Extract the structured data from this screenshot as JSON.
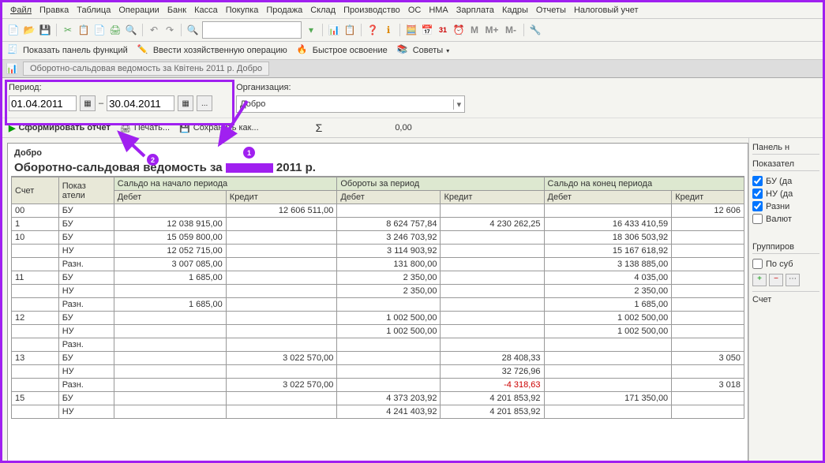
{
  "menu": [
    "Файл",
    "Правка",
    "Таблица",
    "Операции",
    "Банк",
    "Касса",
    "Покупка",
    "Продажа",
    "Склад",
    "Производство",
    "ОС",
    "НМА",
    "Зарплата",
    "Кадры",
    "Отчеты",
    "Налоговый учет"
  ],
  "toolbar2": {
    "show_panel": "Показать панель функций",
    "manual_op": "Ввести хозяйственную операцию",
    "quick_learn": "Быстрое освоение",
    "tips": "Советы"
  },
  "tab": {
    "title": "Оборотно-сальдовая ведомость за Квітень 2011 р. Добро"
  },
  "params": {
    "period_label": "Период:",
    "date_from": "01.04.2011",
    "dash": "–",
    "date_to": "30.04.2011",
    "dots": "...",
    "org_label": "Организация:",
    "org_value": "Добро"
  },
  "actions": {
    "form": "Сформировать отчет",
    "print": "Печать...",
    "save": "Сохранить как...",
    "sigma": "Σ",
    "sum": "0,00"
  },
  "report": {
    "company": "Добро",
    "title_pre": "Оборотно-сальдовая ведомость за ",
    "title_post": " 2011 р.",
    "cols": {
      "acct": "Счет",
      "indic": "Показ\nатели",
      "start": "Сальдо на начало периода",
      "turn": "Обороты за период",
      "end": "Сальдо на конец периода",
      "debit": "Дебет",
      "credit": "Кредит"
    },
    "rows": [
      {
        "a": "00",
        "i": "БУ",
        "sd": "",
        "sc": "12 606 511,00",
        "td": "",
        "tc": "",
        "ed": "",
        "ec": "12 606"
      },
      {
        "a": "1",
        "i": "БУ",
        "sd": "12 038 915,00",
        "sc": "",
        "td": "8 624 757,84",
        "tc": "4 230 262,25",
        "ed": "16 433 410,59",
        "ec": ""
      },
      {
        "a": "10",
        "i": "БУ",
        "sd": "15 059 800,00",
        "sc": "",
        "td": "3 246 703,92",
        "tc": "",
        "ed": "18 306 503,92",
        "ec": ""
      },
      {
        "a": "",
        "i": "НУ",
        "sd": "12 052 715,00",
        "sc": "",
        "td": "3 114 903,92",
        "tc": "",
        "ed": "15 167 618,92",
        "ec": ""
      },
      {
        "a": "",
        "i": "Разн.",
        "sd": "3 007 085,00",
        "sc": "",
        "td": "131 800,00",
        "tc": "",
        "ed": "3 138 885,00",
        "ec": ""
      },
      {
        "a": "11",
        "i": "БУ",
        "sd": "1 685,00",
        "sc": "",
        "td": "2 350,00",
        "tc": "",
        "ed": "4 035,00",
        "ec": ""
      },
      {
        "a": "",
        "i": "НУ",
        "sd": "",
        "sc": "",
        "td": "2 350,00",
        "tc": "",
        "ed": "2 350,00",
        "ec": ""
      },
      {
        "a": "",
        "i": "Разн.",
        "sd": "1 685,00",
        "sc": "",
        "td": "",
        "tc": "",
        "ed": "1 685,00",
        "ec": ""
      },
      {
        "a": "12",
        "i": "БУ",
        "sd": "",
        "sc": "",
        "td": "1 002 500,00",
        "tc": "",
        "ed": "1 002 500,00",
        "ec": ""
      },
      {
        "a": "",
        "i": "НУ",
        "sd": "",
        "sc": "",
        "td": "1 002 500,00",
        "tc": "",
        "ed": "1 002 500,00",
        "ec": ""
      },
      {
        "a": "",
        "i": "Разн.",
        "sd": "",
        "sc": "",
        "td": "",
        "tc": "",
        "ed": "",
        "ec": ""
      },
      {
        "a": "13",
        "i": "БУ",
        "sd": "",
        "sc": "3 022 570,00",
        "td": "",
        "tc": "28 408,33",
        "ed": "",
        "ec": "3 050"
      },
      {
        "a": "",
        "i": "НУ",
        "sd": "",
        "sc": "",
        "td": "",
        "tc": "32 726,96",
        "ed": "",
        "ec": ""
      },
      {
        "a": "",
        "i": "Разн.",
        "sd": "",
        "sc": "3 022 570,00",
        "td": "",
        "tc": "-4 318,63",
        "ed": "",
        "ec": "3 018"
      },
      {
        "a": "15",
        "i": "БУ",
        "sd": "",
        "sc": "",
        "td": "4 373 203,92",
        "tc": "4 201 853,92",
        "ed": "171 350,00",
        "ec": ""
      },
      {
        "a": "",
        "i": "НУ",
        "sd": "",
        "sc": "",
        "td": "4 241 403,92",
        "tc": "4 201 853,92",
        "ed": "",
        "ec": ""
      }
    ]
  },
  "side": {
    "panel": "Панель н",
    "indicators": "Показател",
    "bu": "БУ (да",
    "nu": "НУ (да",
    "diff": "Разни",
    "val": "Валют",
    "group": "Группиров",
    "sub": "По суб",
    "acct": "Счет"
  },
  "toolbar_letters": {
    "m": "М",
    "mp": "М+",
    "mm": "М-"
  }
}
